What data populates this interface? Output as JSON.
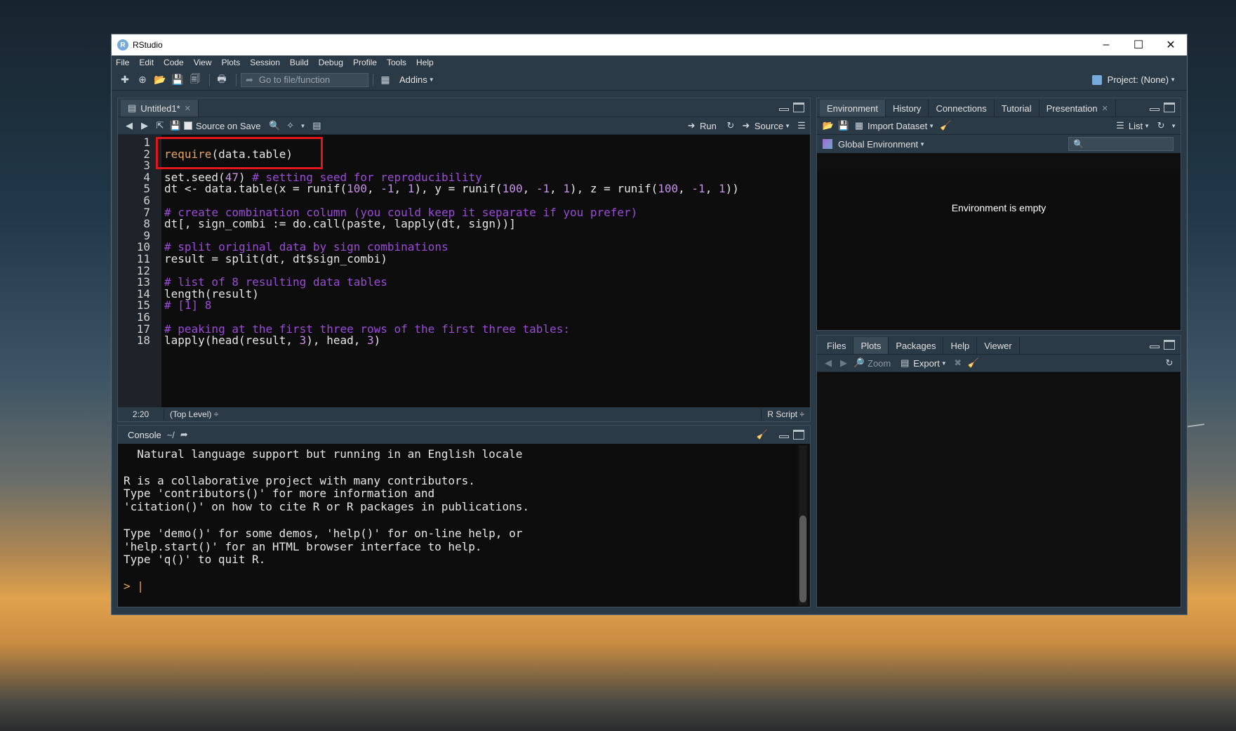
{
  "window": {
    "title": "RStudio",
    "min": "–",
    "max": "☐",
    "close": "✕"
  },
  "menu": [
    "File",
    "Edit",
    "Code",
    "View",
    "Plots",
    "Session",
    "Build",
    "Debug",
    "Profile",
    "Tools",
    "Help"
  ],
  "toolbar": {
    "goto_placeholder": "Go to file/function",
    "addins": "Addins",
    "project": "Project: (None)"
  },
  "editor": {
    "tab": "Untitled1*",
    "source_on_save": "Source on Save",
    "run": "Run",
    "source": "Source",
    "lines": [
      {
        "n": "1",
        "segs": []
      },
      {
        "n": "2",
        "segs": [
          {
            "t": "require",
            "c": "kw"
          },
          {
            "t": "(data.table)",
            "c": ""
          }
        ]
      },
      {
        "n": "3",
        "segs": []
      },
      {
        "n": "4",
        "segs": [
          {
            "t": "set.seed(",
            "c": ""
          },
          {
            "t": "47",
            "c": "num"
          },
          {
            "t": ") ",
            "c": ""
          },
          {
            "t": "# setting seed for reproducibility",
            "c": "cm"
          }
        ]
      },
      {
        "n": "5",
        "segs": [
          {
            "t": "dt <- data.table(x = runif(",
            "c": ""
          },
          {
            "t": "100",
            "c": "num"
          },
          {
            "t": ", ",
            "c": ""
          },
          {
            "t": "-1",
            "c": "num"
          },
          {
            "t": ", ",
            "c": ""
          },
          {
            "t": "1",
            "c": "num"
          },
          {
            "t": "), y = runif(",
            "c": ""
          },
          {
            "t": "100",
            "c": "num"
          },
          {
            "t": ", ",
            "c": ""
          },
          {
            "t": "-1",
            "c": "num"
          },
          {
            "t": ", ",
            "c": ""
          },
          {
            "t": "1",
            "c": "num"
          },
          {
            "t": "), z = runif(",
            "c": ""
          },
          {
            "t": "100",
            "c": "num"
          },
          {
            "t": ", ",
            "c": ""
          },
          {
            "t": "-1",
            "c": "num"
          },
          {
            "t": ", ",
            "c": ""
          },
          {
            "t": "1",
            "c": "num"
          },
          {
            "t": "))",
            "c": ""
          }
        ]
      },
      {
        "n": "6",
        "segs": []
      },
      {
        "n": "7",
        "segs": [
          {
            "t": "# create combination column (you could keep it separate if you prefer)",
            "c": "cm"
          }
        ]
      },
      {
        "n": "8",
        "segs": [
          {
            "t": "dt[, sign_combi := do.call(paste, lapply(dt, sign))]",
            "c": ""
          }
        ]
      },
      {
        "n": "9",
        "segs": []
      },
      {
        "n": "10",
        "segs": [
          {
            "t": "# split original data by sign combinations",
            "c": "cm"
          }
        ]
      },
      {
        "n": "11",
        "segs": [
          {
            "t": "result = split(dt, dt$sign_combi)",
            "c": ""
          }
        ]
      },
      {
        "n": "12",
        "segs": []
      },
      {
        "n": "13",
        "segs": [
          {
            "t": "# list of 8 resulting data tables",
            "c": "cm"
          }
        ]
      },
      {
        "n": "14",
        "segs": [
          {
            "t": "length(result)",
            "c": ""
          }
        ]
      },
      {
        "n": "15",
        "segs": [
          {
            "t": "# [1] 8",
            "c": "cm"
          }
        ]
      },
      {
        "n": "16",
        "segs": []
      },
      {
        "n": "17",
        "segs": [
          {
            "t": "# peaking at the first three rows of the first three tables:",
            "c": "cm"
          }
        ]
      },
      {
        "n": "18",
        "segs": [
          {
            "t": "lapply(head(result, ",
            "c": ""
          },
          {
            "t": "3",
            "c": "num"
          },
          {
            "t": "), head, ",
            "c": ""
          },
          {
            "t": "3",
            "c": "num"
          },
          {
            "t": ")",
            "c": ""
          }
        ]
      }
    ],
    "status": {
      "position": "2:20",
      "level": "(Top Level) ÷",
      "filetype": "R Script ÷"
    }
  },
  "console": {
    "title": "Console",
    "path": "~/",
    "lines": [
      "  Natural language support but running in an English locale",
      "",
      "R is a collaborative project with many contributors.",
      "Type 'contributors()' for more information and",
      "'citation()' on how to cite R or R packages in publications.",
      "",
      "Type 'demo()' for some demos, 'help()' for on-line help, or",
      "'help.start()' for an HTML browser interface to help.",
      "Type 'q()' to quit R.",
      ""
    ],
    "prompt": "> |"
  },
  "environment": {
    "tabs": [
      "Environment",
      "History",
      "Connections",
      "Tutorial",
      "Presentation"
    ],
    "import": "Import Dataset",
    "list": "List",
    "scope": "Global Environment",
    "empty": "Environment is empty"
  },
  "files": {
    "tabs": [
      "Files",
      "Plots",
      "Packages",
      "Help",
      "Viewer"
    ],
    "zoom": "Zoom",
    "export": "Export"
  },
  "colors": {
    "accent": "#75aadb",
    "highlight_box": "#e0161b",
    "keyword": "#e8a35f",
    "comment": "#9b4bd8"
  }
}
